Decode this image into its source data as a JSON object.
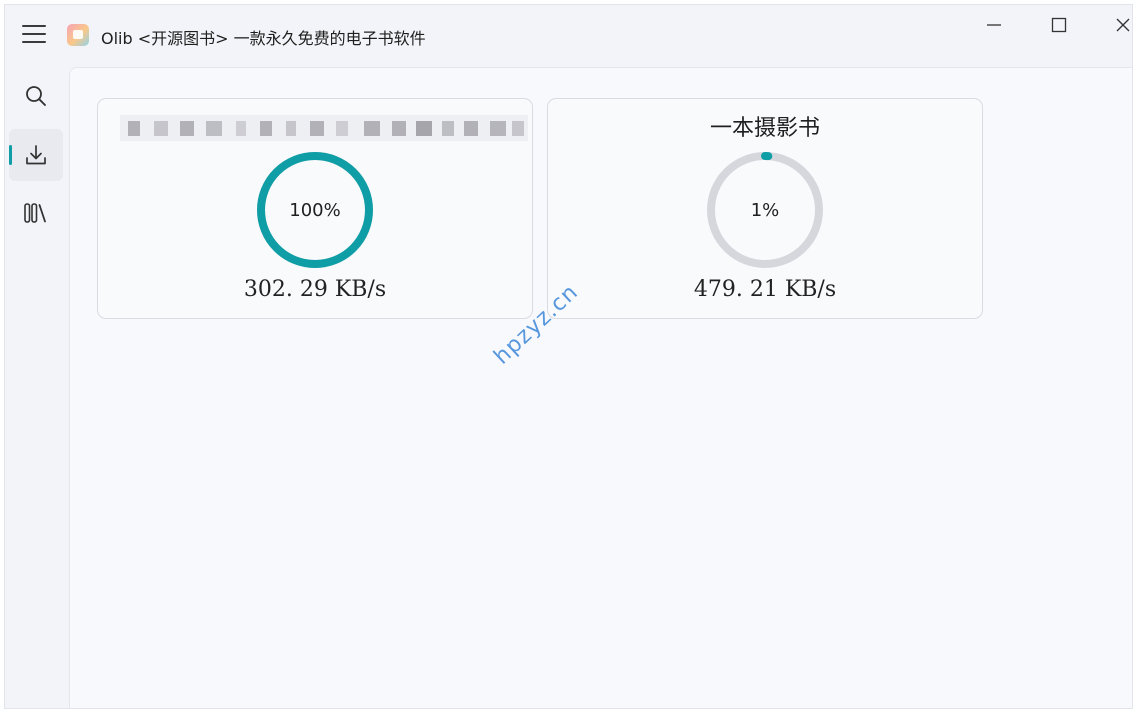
{
  "window": {
    "title": "Olib <开源图书> 一款永久免费的电子书软件"
  },
  "sidebar": {
    "items": [
      {
        "name": "search",
        "icon": "search-icon"
      },
      {
        "name": "downloads",
        "icon": "download-icon",
        "active": true
      },
      {
        "name": "library",
        "icon": "library-books-icon"
      }
    ]
  },
  "downloads": [
    {
      "title": "",
      "progress_percent": 100,
      "progress_label": "100%",
      "speed": "302. 29 KB/s"
    },
    {
      "title": "一本摄影书",
      "progress_percent": 1,
      "progress_label": "1%",
      "speed": "479. 21 KB/s"
    }
  ],
  "colors": {
    "accent": "#0f9ea6",
    "ring_track": "#d6d7dd"
  },
  "watermark": "hpzyz.cn"
}
